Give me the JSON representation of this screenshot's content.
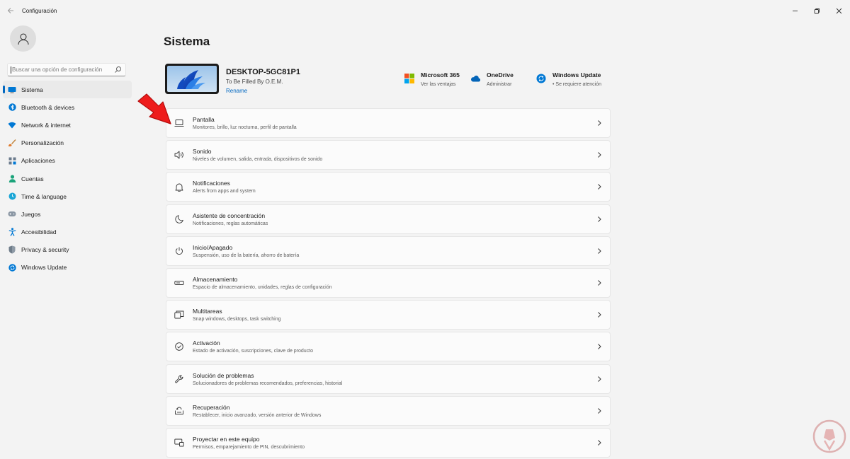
{
  "window": {
    "title": "Configuración"
  },
  "sidebar": {
    "search_placeholder": "Buscar una opción de configuración",
    "items": [
      {
        "label": "Sistema",
        "icon": "display-icon",
        "selected": true
      },
      {
        "label": "Bluetooth & devices",
        "icon": "bluetooth-icon"
      },
      {
        "label": "Network & internet",
        "icon": "wifi-icon"
      },
      {
        "label": "Personalización",
        "icon": "brush-icon"
      },
      {
        "label": "Aplicaciones",
        "icon": "apps-icon"
      },
      {
        "label": "Cuentas",
        "icon": "person-icon"
      },
      {
        "label": "Time & language",
        "icon": "globe-clock-icon"
      },
      {
        "label": "Juegos",
        "icon": "gamepad-icon"
      },
      {
        "label": "Accesibilidad",
        "icon": "accessibility-icon"
      },
      {
        "label": "Privacy & security",
        "icon": "shield-icon"
      },
      {
        "label": "Windows Update",
        "icon": "update-icon"
      }
    ]
  },
  "main": {
    "title": "Sistema",
    "device": {
      "name": "DESKTOP-5GC81P1",
      "oem": "To Be Filled By O.E.M.",
      "rename": "Rename"
    },
    "quick_links": [
      {
        "title": "Microsoft 365",
        "subtitle": "Ver las ventajas",
        "icon": "microsoft-logo-icon"
      },
      {
        "title": "OneDrive",
        "subtitle": "Administrar",
        "icon": "cloud-icon"
      },
      {
        "title": "Windows Update",
        "subtitle": "• Se requiere atención",
        "icon": "update-icon"
      }
    ],
    "settings": [
      {
        "title": "Pantalla",
        "subtitle": "Monitores, brillo, luz nocturna, perfil de pantalla",
        "icon": "monitor-icon"
      },
      {
        "title": "Sonido",
        "subtitle": "Niveles de volumen, salida, entrada, dispositivos de sonido",
        "icon": "speaker-icon"
      },
      {
        "title": "Notificaciones",
        "subtitle": "Alerts from apps and system",
        "icon": "bell-icon"
      },
      {
        "title": "Asistente de concentración",
        "subtitle": "Notificaciones, reglas automáticas",
        "icon": "moon-icon"
      },
      {
        "title": "Inicio/Apagado",
        "subtitle": "Suspensión, uso de la batería, ahorro de batería",
        "icon": "power-icon"
      },
      {
        "title": "Almacenamiento",
        "subtitle": "Espacio de almacenamiento, unidades, reglas de configuración",
        "icon": "storage-icon"
      },
      {
        "title": "Multitareas",
        "subtitle": "Snap windows, desktops, task switching",
        "icon": "multitask-icon"
      },
      {
        "title": "Activación",
        "subtitle": "Estado de activación, suscripciones, clave de producto",
        "icon": "check-circle-icon"
      },
      {
        "title": "Solución de problemas",
        "subtitle": "Solucionadores de problemas recomendados, preferencias, historial",
        "icon": "wrench-icon"
      },
      {
        "title": "Recuperación",
        "subtitle": "Restablecer, inicio avanzado, versión anterior de Windows",
        "icon": "recovery-icon"
      },
      {
        "title": "Proyectar en este equipo",
        "subtitle": "Permisos, emparejamiento de PIN, descubrimiento",
        "icon": "project-icon"
      }
    ]
  },
  "colors": {
    "accent": "#0067c0",
    "background": "#f3f3f3",
    "card": "#fbfbfb",
    "annotation_arrow": "#ee1c1c"
  }
}
